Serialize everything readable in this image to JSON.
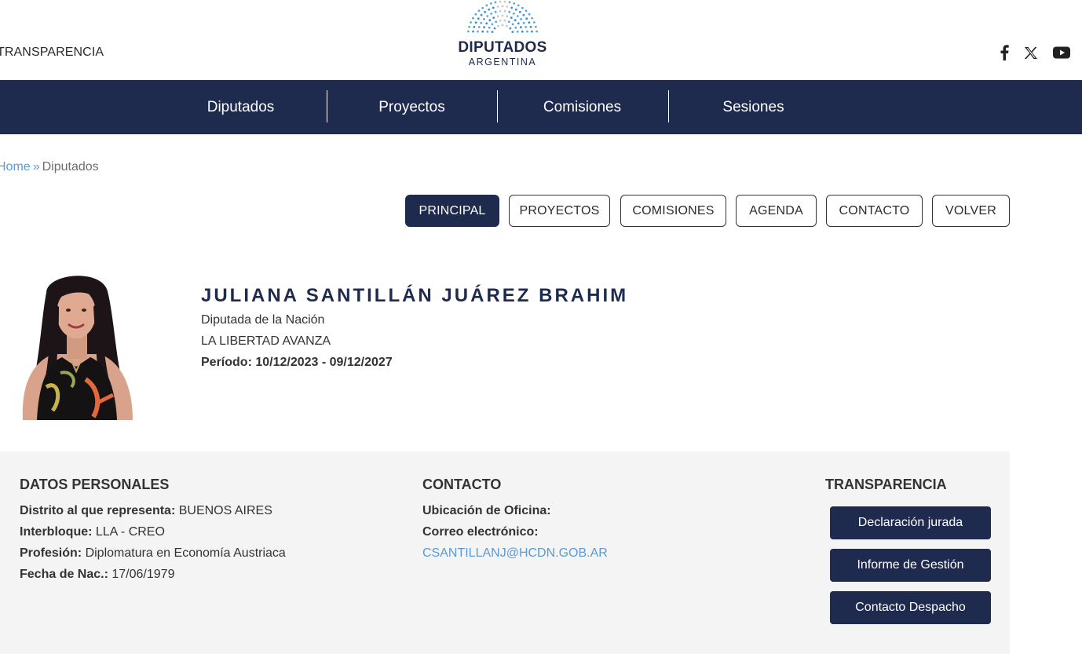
{
  "header": {
    "transparency_link": "TRANSPARENCIA",
    "logo_line1": "DIPUTADOS",
    "logo_line2": "ARGENTINA",
    "social": [
      "facebook-icon",
      "x-icon",
      "youtube-icon"
    ]
  },
  "nav": {
    "items": [
      "Diputados",
      "Proyectos",
      "Comisiones",
      "Sesiones"
    ]
  },
  "breadcrumb": {
    "home": "Home",
    "separator": "»",
    "current": "Diputados"
  },
  "tabs": [
    {
      "label": "PRINCIPAL",
      "active": true
    },
    {
      "label": "PROYECTOS",
      "active": false
    },
    {
      "label": "COMISIONES",
      "active": false
    },
    {
      "label": "AGENDA",
      "active": false
    },
    {
      "label": "CONTACTO",
      "active": false
    },
    {
      "label": "VOLVER",
      "active": false
    }
  ],
  "profile": {
    "name": "JULIANA SANTILLÁN JUÁREZ BRAHIM",
    "role": "Diputada de la Nación",
    "party": "LA LIBERTAD AVANZA",
    "period": "Período: 10/12/2023 - 09/12/2027"
  },
  "personal": {
    "title": "DATOS PERSONALES",
    "district_label": "Distrito al que representa:",
    "district_value": " BUENOS AIRES",
    "bloc_label": "Interbloque:",
    "bloc_value": " LLA - CREO",
    "profession_label": "Profesión:",
    "profession_value": " Diplomatura en Economía Austriaca",
    "birth_label": "Fecha de Nac.:",
    "birth_value": " 17/06/1979"
  },
  "contact": {
    "title": "CONTACTO",
    "office_label": "Ubicación de Oficina:",
    "email_label": "Correo electrónico:",
    "email_value": "CSANTILLANJ@HCDN.GOB.AR"
  },
  "transparency": {
    "title": "TRANSPARENCIA",
    "buttons": [
      "Declaración jurada",
      "Informe de Gestión",
      "Contacto Despacho"
    ]
  },
  "colors": {
    "brand_navy": "#1f2a4f",
    "link_blue": "#5b9bd5",
    "panel_bg": "#f4f4f4"
  }
}
